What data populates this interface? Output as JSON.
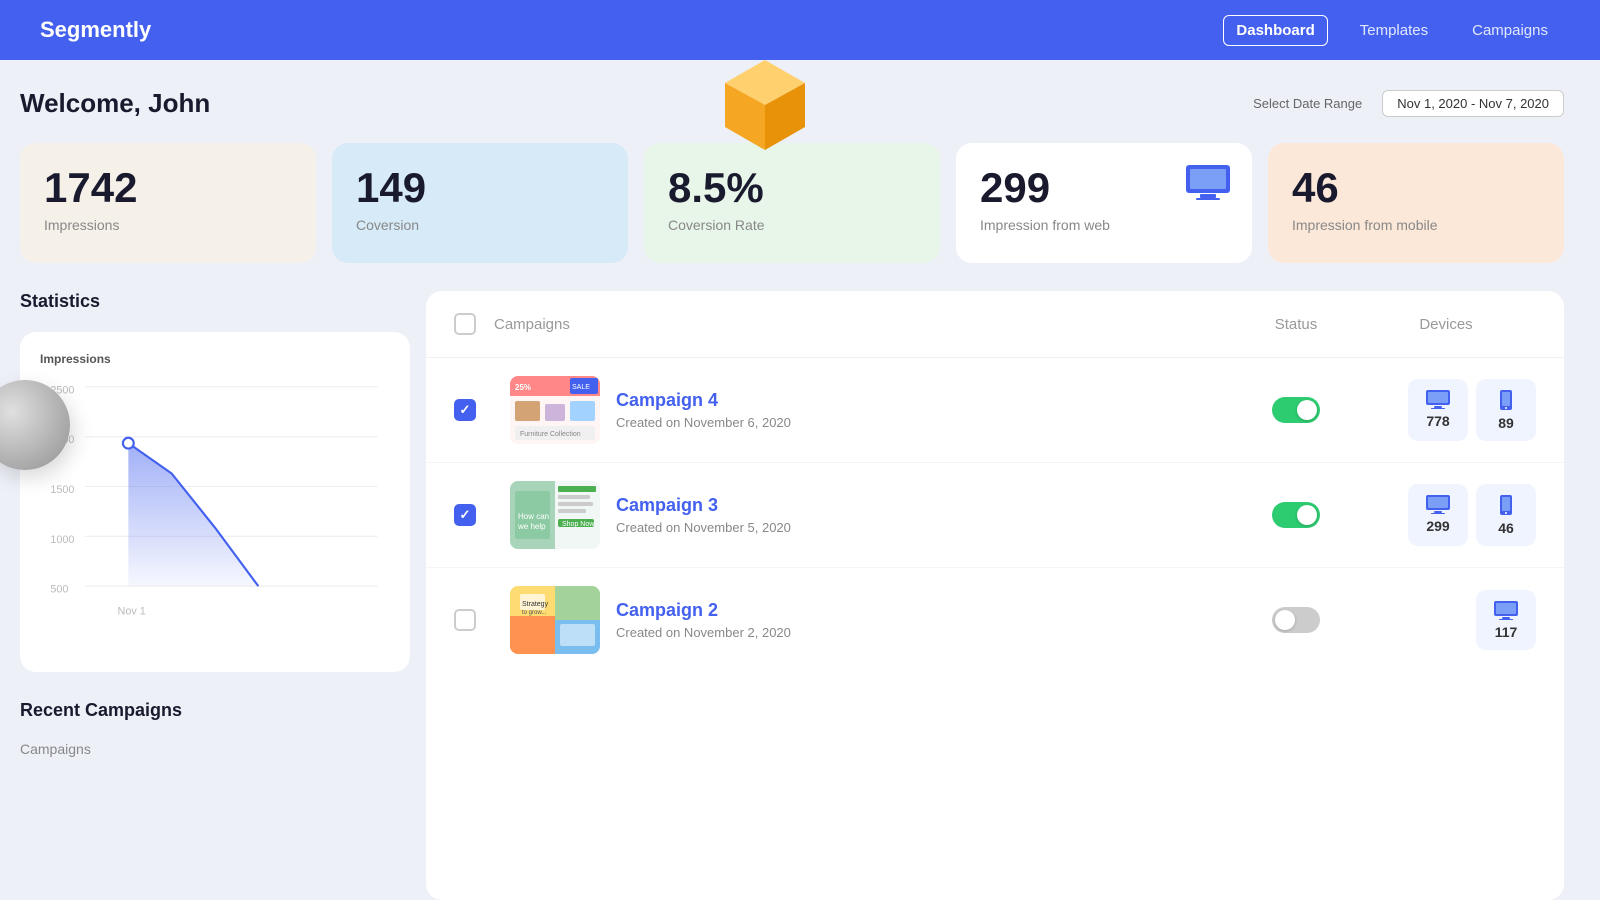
{
  "header": {
    "logo": "Segmently",
    "nav": [
      {
        "label": "Dashboard",
        "active": true
      },
      {
        "label": "Templates",
        "active": false
      },
      {
        "label": "Campaigns",
        "active": false
      }
    ]
  },
  "welcome": {
    "greeting": "Welcome, John",
    "date_range_label": "Select Date Range",
    "date_range_value": "Nov 1, 2020 - Nov 7, 2020"
  },
  "stats": [
    {
      "id": "impressions",
      "number": "1742",
      "label": "Impressions",
      "card_class": "card-cream",
      "has_icon": false
    },
    {
      "id": "conversion",
      "number": "149",
      "label": "Coversion",
      "card_class": "card-blue-light",
      "has_icon": false
    },
    {
      "id": "conversion-rate",
      "number": "8.5%",
      "label": "Coversion Rate",
      "card_class": "card-green-light",
      "has_icon": false
    },
    {
      "id": "impression-web",
      "number": "299",
      "label": "Impression from web",
      "card_class": "card-white",
      "has_icon": true
    },
    {
      "id": "impression-mobile",
      "number": "46",
      "label": "Impression from mobile",
      "card_class": "card-peach",
      "has_icon": false
    }
  ],
  "statistics": {
    "title": "Statistics",
    "chart": {
      "y_label": "Impressions",
      "y_values": [
        "2500",
        "2000",
        "1500",
        "1000",
        "500"
      ],
      "x_label": "Nov 1"
    }
  },
  "campaigns_table": {
    "headers": {
      "campaign": "Campaigns",
      "status": "Status",
      "devices": "Devices"
    },
    "rows": [
      {
        "id": "campaign4",
        "name": "Campaign 4",
        "date": "Created on November 6, 2020",
        "checked": true,
        "active": true,
        "desktop_count": "778",
        "mobile_count": "89",
        "thumb_color1": "#e8f0fe",
        "thumb_color2": "#4361ee"
      },
      {
        "id": "campaign3",
        "name": "Campaign 3",
        "date": "Created on November 5, 2020",
        "checked": true,
        "active": true,
        "desktop_count": "299",
        "mobile_count": "46",
        "thumb_color1": "#c8e6c9",
        "thumb_color2": "#388e3c"
      },
      {
        "id": "campaign2",
        "name": "Campaign 2",
        "date": "Created on November 2, 2020",
        "checked": false,
        "active": false,
        "desktop_count": "117",
        "mobile_count": null,
        "thumb_color1": "#ffe082",
        "thumb_color2": "#f57c00"
      }
    ]
  },
  "recent": {
    "title": "Recent Campaigns",
    "label": "Campaigns"
  }
}
